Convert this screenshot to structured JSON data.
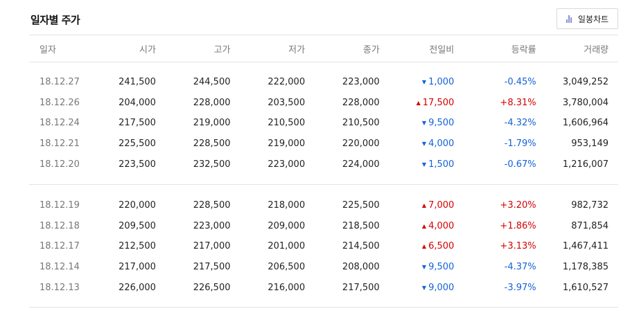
{
  "title": "일자별 주가",
  "chart_button": {
    "label": "일봉차트",
    "icon": "bar-chart-icon"
  },
  "colors": {
    "up": "#d60000",
    "down": "#1461d9",
    "icon": "#8a8fd8"
  },
  "columns": [
    "일자",
    "시가",
    "고가",
    "저가",
    "종가",
    "전일비",
    "등락률",
    "거래량"
  ],
  "groups": [
    [
      {
        "date": "18.12.27",
        "open": "241,500",
        "high": "244,500",
        "low": "222,000",
        "close": "223,000",
        "dir": "down",
        "change": "1,000",
        "rate": "-0.45%",
        "volume": "3,049,252"
      },
      {
        "date": "18.12.26",
        "open": "204,000",
        "high": "228,000",
        "low": "203,500",
        "close": "228,000",
        "dir": "up",
        "change": "17,500",
        "rate": "+8.31%",
        "volume": "3,780,004"
      },
      {
        "date": "18.12.24",
        "open": "217,500",
        "high": "219,000",
        "low": "210,500",
        "close": "210,500",
        "dir": "down",
        "change": "9,500",
        "rate": "-4.32%",
        "volume": "1,606,964"
      },
      {
        "date": "18.12.21",
        "open": "225,500",
        "high": "228,500",
        "low": "219,000",
        "close": "220,000",
        "dir": "down",
        "change": "4,000",
        "rate": "-1.79%",
        "volume": "953,149"
      },
      {
        "date": "18.12.20",
        "open": "223,500",
        "high": "232,500",
        "low": "223,000",
        "close": "224,000",
        "dir": "down",
        "change": "1,500",
        "rate": "-0.67%",
        "volume": "1,216,007"
      }
    ],
    [
      {
        "date": "18.12.19",
        "open": "220,000",
        "high": "228,500",
        "low": "218,000",
        "close": "225,500",
        "dir": "up",
        "change": "7,000",
        "rate": "+3.20%",
        "volume": "982,732"
      },
      {
        "date": "18.12.18",
        "open": "209,500",
        "high": "223,000",
        "low": "209,000",
        "close": "218,500",
        "dir": "up",
        "change": "4,000",
        "rate": "+1.86%",
        "volume": "871,854"
      },
      {
        "date": "18.12.17",
        "open": "212,500",
        "high": "217,000",
        "low": "201,000",
        "close": "214,500",
        "dir": "up",
        "change": "6,500",
        "rate": "+3.13%",
        "volume": "1,467,411"
      },
      {
        "date": "18.12.14",
        "open": "217,000",
        "high": "217,500",
        "low": "206,500",
        "close": "208,000",
        "dir": "down",
        "change": "9,500",
        "rate": "-4.37%",
        "volume": "1,178,385"
      },
      {
        "date": "18.12.13",
        "open": "226,000",
        "high": "226,500",
        "low": "216,000",
        "close": "217,500",
        "dir": "down",
        "change": "9,000",
        "rate": "-3.97%",
        "volume": "1,610,527"
      }
    ]
  ]
}
